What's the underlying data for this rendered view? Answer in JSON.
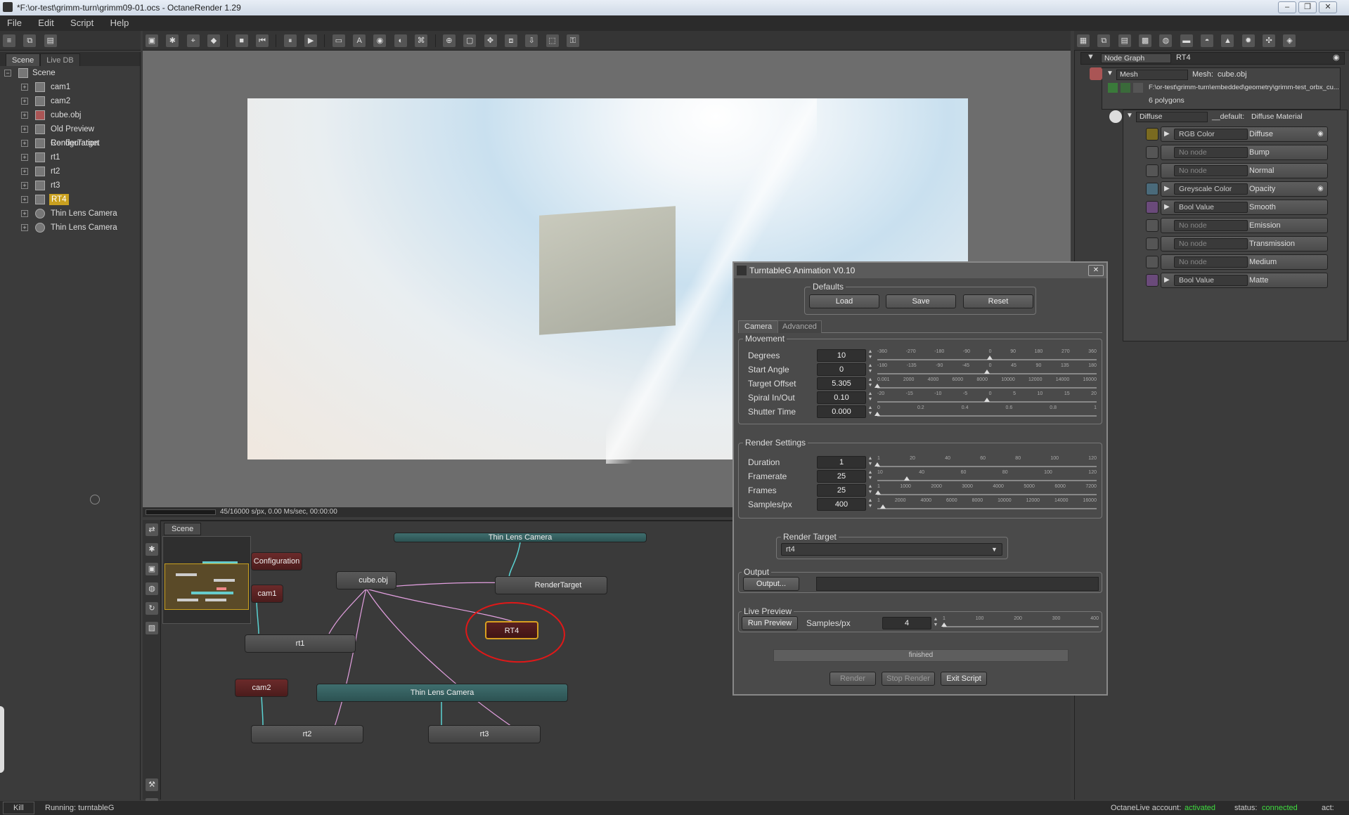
{
  "window": {
    "title": "*F:\\or-test\\grimm-turn\\grimm09-01.ocs - OctaneRender 1.29",
    "minimize": "–",
    "restore": "❐",
    "close": "✕"
  },
  "menu": [
    "File",
    "Edit",
    "Script",
    "Help"
  ],
  "scene_tabs": [
    "Scene",
    "Live DB"
  ],
  "tree": [
    {
      "label": "Scene",
      "kind": "root"
    },
    {
      "label": "cam1"
    },
    {
      "label": "cam2"
    },
    {
      "label": "cube.obj"
    },
    {
      "label": "Old Preview Configuration"
    },
    {
      "label": "RenderTarget"
    },
    {
      "label": "rt1"
    },
    {
      "label": "rt2"
    },
    {
      "label": "rt3"
    },
    {
      "label": "RT4"
    },
    {
      "label": "Thin Lens Camera"
    },
    {
      "label": "Thin Lens Camera"
    }
  ],
  "viewport": {
    "status": "45/16000 s/px, 0.00 Ms/sec, 00:00:00"
  },
  "nodegraph": {
    "tab": "Scene",
    "nodes": {
      "config": "Configuration",
      "cam1": "cam1",
      "cube": "cube.obj",
      "rendertarget": "RenderTarget",
      "thinlens_top": "Thin Lens Camera",
      "rt1": "rt1",
      "rt4": "RT4",
      "cam2": "cam2",
      "thinlens": "Thin Lens Camera",
      "rt2": "rt2",
      "rt3": "rt3"
    }
  },
  "nodeinspector": {
    "dropdown": "Node Graph",
    "node": "RT4",
    "mesh_type": "Mesh",
    "mesh_label": "Mesh:",
    "mesh_name": "cube.obj",
    "mesh_path": "F:\\or-test\\grimm-turn\\embedded\\geometry\\grimm-test_orbx_cu...",
    "polygons": "6 polygons",
    "material_type": "Diffuse",
    "material_default": "__default:",
    "material_name": "Diffuse Material",
    "pins": [
      {
        "value": "RGB Color",
        "name": "Diffuse"
      },
      {
        "value": "No node",
        "name": "Bump"
      },
      {
        "value": "No node",
        "name": "Normal"
      },
      {
        "value": "Greyscale Color",
        "name": "Opacity"
      },
      {
        "value": "Bool Value",
        "name": "Smooth"
      },
      {
        "value": "No node",
        "name": "Emission"
      },
      {
        "value": "No node",
        "name": "Transmission"
      },
      {
        "value": "No node",
        "name": "Medium"
      },
      {
        "value": "Bool Value",
        "name": "Matte"
      }
    ]
  },
  "dialog": {
    "title": "TurntableG Animation V0.10",
    "defaults_label": "Defaults",
    "load": "Load",
    "save": "Save",
    "reset": "Reset",
    "tabs": [
      "Camera",
      "Advanced"
    ],
    "movement_label": "Movement",
    "movement": [
      {
        "label": "Degrees",
        "value": "10",
        "ticks": [
          "-360",
          "-270",
          "-180",
          "-90",
          "0",
          "90",
          "180",
          "270",
          "360"
        ],
        "pos": 0.514
      },
      {
        "label": "Start Angle",
        "value": "0",
        "ticks": [
          "-180",
          "-135",
          "-90",
          "-45",
          "0",
          "45",
          "90",
          "135",
          "180"
        ],
        "pos": 0.5
      },
      {
        "label": "Target Offset",
        "value": "5.305",
        "ticks": [
          "0.001",
          "2000",
          "4000",
          "6000",
          "8000",
          "10000",
          "12000",
          "14000",
          "16000"
        ],
        "pos": 0.0
      },
      {
        "label": "Spiral In/Out",
        "value": "0.10",
        "ticks": [
          "-20",
          "-15",
          "-10",
          "-5",
          "0",
          "5",
          "10",
          "15",
          "20"
        ],
        "pos": 0.5
      },
      {
        "label": "Shutter Time",
        "value": "0.000",
        "ticks": [
          "0",
          "0.2",
          "0.4",
          "0.6",
          "0.8",
          "1"
        ],
        "pos": 0.0
      }
    ],
    "render_settings_label": "Render Settings",
    "render_settings": [
      {
        "label": "Duration",
        "value": "1",
        "ticks": [
          "1",
          "20",
          "40",
          "60",
          "80",
          "100",
          "120"
        ],
        "pos": 0.0
      },
      {
        "label": "Framerate",
        "value": "25",
        "ticks": [
          "10",
          "40",
          "60",
          "80",
          "100",
          "120"
        ],
        "pos": 0.136
      },
      {
        "label": "Frames",
        "value": "25",
        "ticks": [
          "1",
          "1000",
          "2000",
          "3000",
          "4000",
          "5000",
          "6000",
          "7200"
        ],
        "pos": 0.003
      },
      {
        "label": "Samples/px",
        "value": "400",
        "ticks": [
          "1",
          "2000",
          "4000",
          "6000",
          "8000",
          "10000",
          "12000",
          "14000",
          "16000"
        ],
        "pos": 0.025
      }
    ],
    "render_target_label": "Render Target",
    "render_target_value": "rt4",
    "output_label": "Output",
    "output_button": "Output...",
    "output_path": "",
    "live_preview_label": "Live Preview",
    "run_preview": "Run Preview",
    "preview_samples_label": "Samples/px",
    "preview_samples": "4",
    "preview_ticks": [
      "1",
      "100",
      "200",
      "300",
      "400"
    ],
    "preview_pos": 0.0075,
    "progress": "finished",
    "render": "Render",
    "stop_render": "Stop Render",
    "exit_script": "Exit Script"
  },
  "statusbar": {
    "kill": "Kill",
    "running": "Running: turntableG",
    "account_label": "OctaneLive account:",
    "account_value": "activated",
    "status_label": "status:",
    "status_value": "connected",
    "act_label": "act:"
  },
  "colors": {
    "accent_green": "#3fdc3f",
    "annotation_red": "#e01818",
    "selection_gold": "#d8a020"
  }
}
